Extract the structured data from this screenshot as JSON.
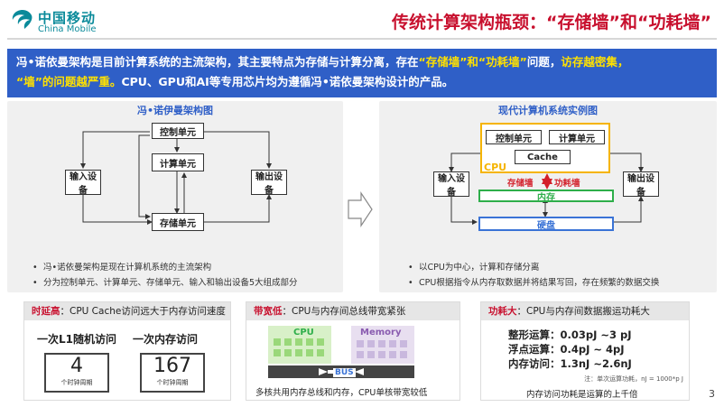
{
  "header": {
    "logo_cn": "中国移动",
    "logo_en": "China Mobile",
    "title": "传统计算架构瓶颈：“存储墙”和“功耗墙”"
  },
  "banner": {
    "p1": "冯•诺依曼架构是目前计算系统的主流架构，其主要特点为存储与计算分离，存在",
    "h1": "“存储墙”和“功耗墙”",
    "p2": "问题，",
    "h2": "访存越密集，",
    "h3": "“墙”的问题越严重。",
    "p3": "CPU、GPU和AI等专用芯片均为遵循冯•诺依曼架构设计的产品。"
  },
  "left_panel": {
    "title": "冯•诺伊曼架构图",
    "boxes": {
      "control": "控制单元",
      "compute": "计算单元",
      "storage": "存储单元",
      "input": "输入设备",
      "output": "输出设备"
    },
    "bullets": [
      "冯•诺依曼架构是现在计算机系统的主流架构",
      "分为控制单元、计算单元、存储单元、输入和输出设备5大组成部分"
    ]
  },
  "right_panel": {
    "title": "现代计算机系统实例图",
    "boxes": {
      "control": "控制单元",
      "compute": "计算单元",
      "cache": "Cache",
      "cpu": "CPU",
      "memory": "内存",
      "disk": "硬盘",
      "input": "输入设备",
      "output": "输出设备",
      "storage_wall": "存储墙",
      "power_wall": "功耗墙"
    },
    "bullets": [
      "以CPU为中心，计算和存储分离",
      "CPU根据指令从内存取数据并将结果写回，存在频繁的数据交换"
    ]
  },
  "card_latency": {
    "head_key": "时延高",
    "head_rest": "：CPU Cache访问远大于内存访问速度",
    "label1": "一次L1随机访问",
    "label2": "一次内存访问",
    "value1": "4",
    "value2": "167",
    "unit1": "个时钟周期",
    "unit2": "个时钟周期"
  },
  "card_bandwidth": {
    "head_key": "带宽低",
    "head_rest": "：CPU与内存间总线带宽紧张",
    "cpu_label": "CPU",
    "memory_label": "Memory",
    "bus_label": "BUS",
    "caption": "多核共用内存总线和内存，CPU单核带宽较低"
  },
  "card_power": {
    "head_key": "功耗大",
    "head_rest": "：CPU与内存间数据搬运功耗大",
    "lines": [
      "整形运算：0.03pJ ~3 pJ",
      "浮点运算：0.4pJ ~ 4pJ",
      "内存访问：1.3nJ ~2.6nJ"
    ],
    "note": "注：单次运算功耗，nJ = 1000*p J",
    "caption": "内存访问功耗是运算的上千倍"
  },
  "page_number": "3",
  "colors": {
    "brand_teal": "#0a8a9a",
    "title_red": "#c8102e",
    "banner_blue": "#2f5fc7",
    "highlight_yellow": "#ffe100",
    "cpu_orange": "#f5b400",
    "memory_green": "#2eae4a",
    "disk_blue": "#3a73d6"
  }
}
